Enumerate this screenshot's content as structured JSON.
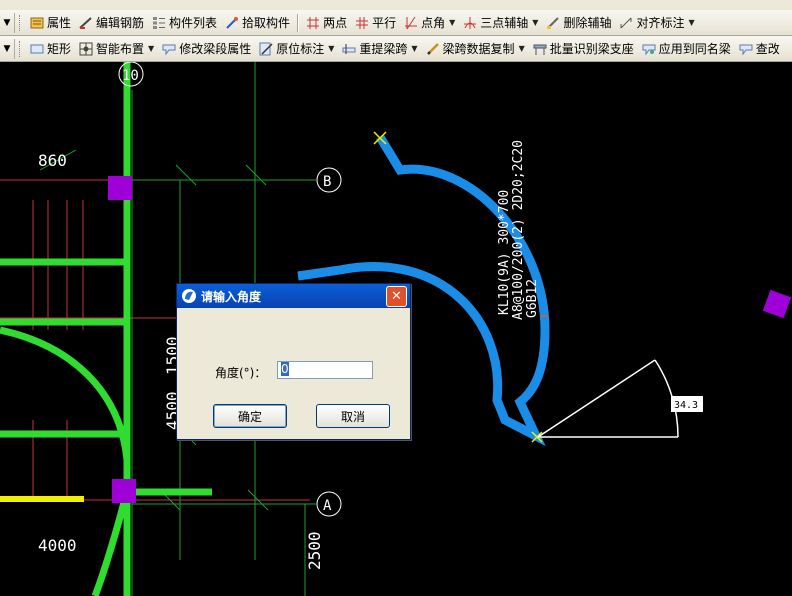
{
  "toolbar1": {
    "items": [
      {
        "label": "属性",
        "icon": "properties-icon"
      },
      {
        "label": "编辑钢筋",
        "icon": "edit-rebar-icon"
      },
      {
        "label": "构件列表",
        "icon": "component-list-icon"
      },
      {
        "label": "拾取构件",
        "icon": "pick-component-icon"
      },
      {
        "label": "两点",
        "icon": "two-point-icon"
      },
      {
        "label": "平行",
        "icon": "parallel-icon"
      },
      {
        "label": "点角",
        "icon": "point-angle-icon"
      },
      {
        "label": "三点辅轴",
        "icon": "three-point-axis-icon"
      },
      {
        "label": "删除辅轴",
        "icon": "delete-axis-icon"
      },
      {
        "label": "对齐标注",
        "icon": "align-dimension-icon"
      }
    ]
  },
  "toolbar2": {
    "items": [
      {
        "label": "矩形",
        "icon": "rectangle-icon"
      },
      {
        "label": "智能布置",
        "icon": "smart-layout-icon"
      },
      {
        "label": "修改梁段属性",
        "icon": "modify-beam-icon"
      },
      {
        "label": "原位标注",
        "icon": "in-situ-label-icon"
      },
      {
        "label": "重提梁跨",
        "icon": "re-extract-span-icon"
      },
      {
        "label": "梁跨数据复制",
        "icon": "copy-span-icon"
      },
      {
        "label": "批量识别梁支座",
        "icon": "batch-support-icon"
      },
      {
        "label": "应用到同名梁",
        "icon": "apply-same-beam-icon"
      },
      {
        "label": "查改",
        "icon": "query-icon"
      }
    ]
  },
  "cad": {
    "axis_labels": {
      "top": "10",
      "b": "B",
      "a": "A"
    },
    "dims": {
      "d860": "860",
      "d1500": "1500",
      "d4500": "4500",
      "d4000": "4000",
      "d2500": "2500"
    },
    "beam_annotation_1": "KL10(9A) 300*700",
    "beam_annotation_2": "A8@100/200(2) 2D20;2C20",
    "beam_annotation_3": "G6B12",
    "angle_value": "34.3"
  },
  "dialog": {
    "title": "请输入角度",
    "field_label": "角度(°)：",
    "field_value": "0",
    "ok_label": "确定",
    "cancel_label": "取消"
  }
}
